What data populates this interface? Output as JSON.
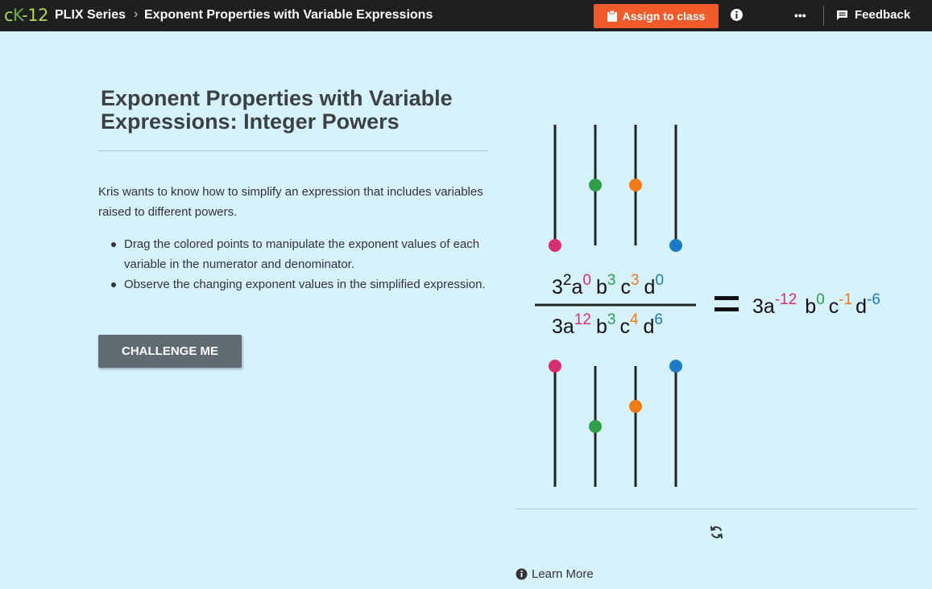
{
  "topbar": {
    "logo": {
      "c": "c",
      "k": "K",
      "num": "-12"
    },
    "series": "PLIX Series",
    "separator": "›",
    "title": "Exponent Properties with Variable Expressions",
    "assign_label": "Assign to class",
    "more": "•••",
    "feedback_label": "Feedback"
  },
  "content": {
    "title": "Exponent Properties with Variable Expressions: Integer Powers",
    "description": "Kris wants to know how to simplify an expression that includes variables raised to different powers.",
    "bullets": [
      "Drag the colored points to manipulate the exponent values of each variable in the numerator and denominator.",
      "Observe the changing exponent values in the simplified expression."
    ],
    "challenge_label": "CHALLENGE ME",
    "learn_more": "Learn More"
  },
  "colors": {
    "a": "#d6306f",
    "b": "#2e9e48",
    "c": "#f07a14",
    "d": "#1a7cc2",
    "accent": "#f15a2b",
    "topbar": "#1e1f21",
    "background": "#d6f2fd"
  },
  "sliders": {
    "numerator": {
      "a": 0,
      "b": 3,
      "c": 3,
      "d": 0
    },
    "denominator": {
      "a": 12,
      "b": 3,
      "c": 4,
      "d": 6
    },
    "range": [
      0,
      12
    ]
  },
  "expression": {
    "numerator": {
      "coef": "3",
      "coef_exp": "2",
      "a": "a",
      "a_exp": "0",
      "b": "b",
      "b_exp": "3",
      "c": "c",
      "c_exp": "3",
      "d": "d",
      "d_exp": "0"
    },
    "denominator": {
      "coef": "3a",
      "a_exp": "12",
      "b": "b",
      "b_exp": "3",
      "c": "c",
      "c_exp": "4",
      "d": "d",
      "d_exp": "6"
    },
    "equals": "=",
    "result": {
      "coef": "3a",
      "a_exp": "-12",
      "b": "b",
      "b_exp": "0",
      "c": "c",
      "c_exp": "-1",
      "d": "d",
      "d_exp": "-6"
    }
  },
  "icons": {
    "assign": "clipboard-icon",
    "info": "info-icon",
    "more": "more-icon",
    "feedback": "feedback-icon",
    "reset": "reset-icon",
    "learn": "info-icon"
  }
}
